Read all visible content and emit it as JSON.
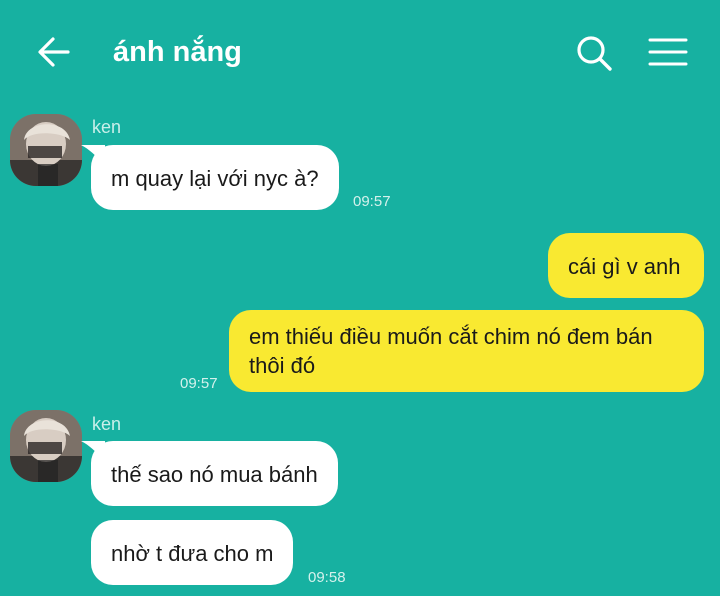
{
  "header": {
    "title": "ánh nắng",
    "back_icon": "arrow-left-icon",
    "search_icon": "search-icon",
    "menu_icon": "hamburger-menu-icon"
  },
  "colors": {
    "background": "#17b1a1",
    "incoming_bubble": "#ffffff",
    "outgoing_bubble": "#f9e931",
    "header_text": "#ffffff"
  },
  "messages": [
    {
      "direction": "incoming",
      "sender": "ken",
      "text": "m quay lại với nyc à?",
      "time": "09:57"
    },
    {
      "direction": "outgoing",
      "text": "cái gì v anh"
    },
    {
      "direction": "outgoing",
      "text": "em thiếu điều muốn cắt chim nó đem bán thôi đó",
      "time": "09:57"
    },
    {
      "direction": "incoming",
      "sender": "ken",
      "text": "thế sao nó mua bánh"
    },
    {
      "direction": "incoming",
      "text": "nhờ t đưa cho m",
      "time": "09:58"
    }
  ]
}
